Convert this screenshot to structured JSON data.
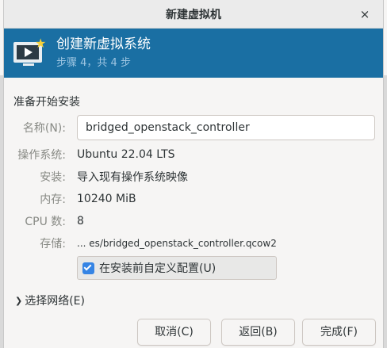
{
  "window": {
    "title": "新建虚拟机",
    "close_symbol": "×"
  },
  "header": {
    "title": "创建新虚拟系统",
    "step_text": "步骤 4，共 4 步",
    "icon": "new-vm-monitor-icon"
  },
  "section_title": "准备开始安装",
  "form": {
    "name_label": "名称(N):",
    "name_value": "bridged_openstack_controller",
    "os_label": "操作系统:",
    "os_value": "Ubuntu 22.04 LTS",
    "install_label": "安装:",
    "install_value": "导入现有操作系统映像",
    "memory_label": "内存:",
    "memory_value": "10240 MiB",
    "cpu_label": "CPU 数:",
    "cpu_value": "8",
    "storage_label": "存储:",
    "storage_value": "... es/bridged_openstack_controller.qcow2"
  },
  "customize": {
    "label": "在安装前自定义配置(U)",
    "checked": true
  },
  "network_expander": {
    "arrow": "❯",
    "label": "选择网络(E)"
  },
  "buttons": {
    "cancel": "取消(C)",
    "back": "返回(B)",
    "finish": "完成(F)"
  },
  "colors": {
    "header_bg": "#1a6fa3",
    "checkbox_accent": "#3584e4",
    "star": "#f5d13b"
  }
}
